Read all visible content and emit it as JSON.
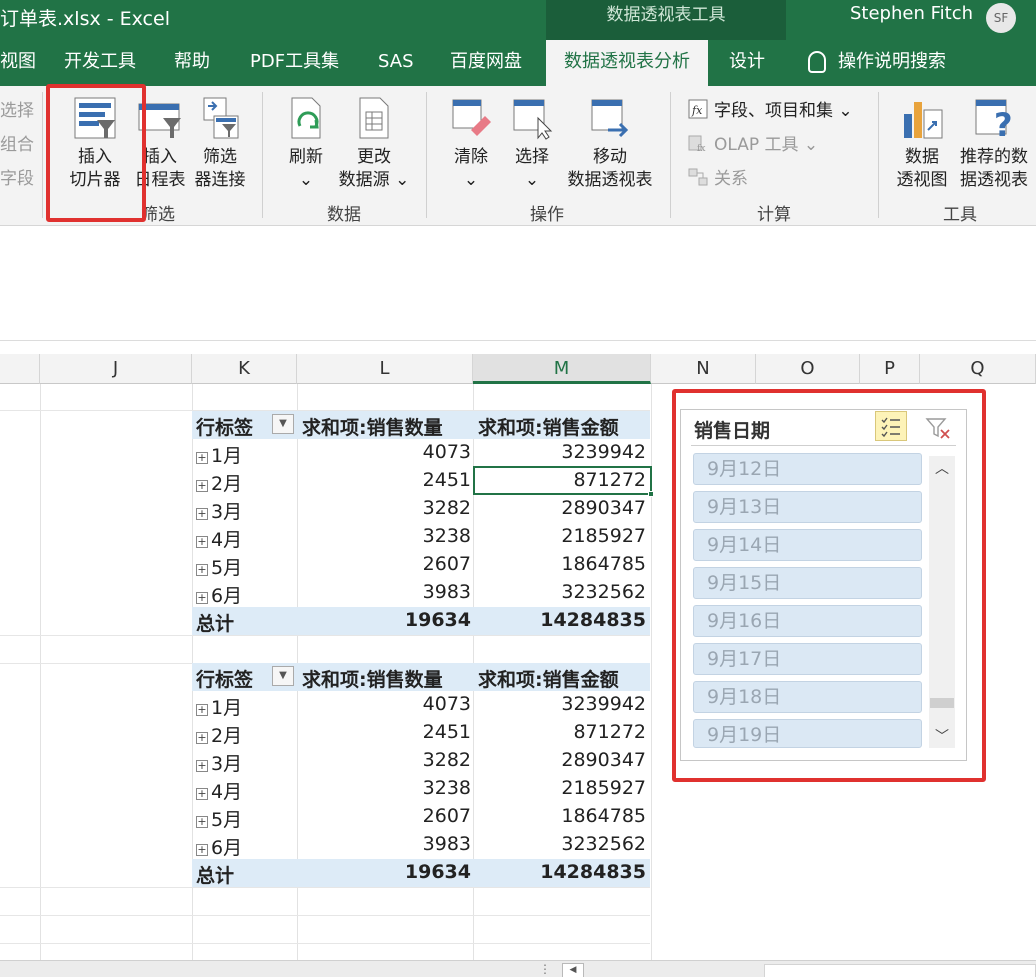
{
  "window": {
    "title": "订单表.xlsx  -  Excel",
    "context_tab_group": "数据透视表工具",
    "user_name": "Stephen Fitch",
    "user_initials": "SF"
  },
  "tabs": {
    "view": "视图",
    "developer": "开发工具",
    "help": "帮助",
    "pdf": "PDF工具集",
    "sas": "SAS",
    "baidu": "百度网盘",
    "pivot_analyze": "数据透视表分析",
    "design": "设计",
    "tell_me": "操作说明搜索"
  },
  "ribbon": {
    "group_select": {
      "item1": "选择",
      "item2": "组合",
      "item3": "字段"
    },
    "insert_slicer": {
      "line1": "插入",
      "line2": "切片器"
    },
    "insert_timeline": {
      "line1": "插入",
      "line2": "日程表"
    },
    "filter_connections": {
      "line1": "筛选",
      "line2": "器连接"
    },
    "filter_group_label": "筛选",
    "refresh": {
      "line1": "刷新",
      "line2": "⌄"
    },
    "change_source": {
      "line1": "更改",
      "line2": "数据源 ⌄"
    },
    "data_group_label": "数据",
    "clear": {
      "line1": "清除",
      "line2": "⌄"
    },
    "select": {
      "line1": "选择",
      "line2": "⌄"
    },
    "move": {
      "line1": "移动",
      "line2": "数据透视表"
    },
    "actions_group_label": "操作",
    "fields_items_sets": "字段、项目和集 ⌄",
    "olap_tools": "OLAP 工具 ⌄",
    "relationships": "关系",
    "calc_group_label": "计算",
    "pivot_chart": {
      "line1": "数据",
      "line2": "透视图"
    },
    "recommended_pivot": {
      "line1": "推荐的数",
      "line2": "据透视表"
    },
    "tools_group_label": "工具"
  },
  "columns": [
    "J",
    "K",
    "L",
    "M",
    "N",
    "O",
    "P",
    "Q"
  ],
  "pivot_header": {
    "row_label": "行标签",
    "sum_qty": "求和项:销售数量",
    "sum_amount": "求和项:销售金额"
  },
  "pivot1": [
    {
      "label": "1月",
      "qty": "4073",
      "amount": "3239942"
    },
    {
      "label": "2月",
      "qty": "2451",
      "amount": "871272"
    },
    {
      "label": "3月",
      "qty": "3282",
      "amount": "2890347"
    },
    {
      "label": "4月",
      "qty": "3238",
      "amount": "2185927"
    },
    {
      "label": "5月",
      "qty": "2607",
      "amount": "1864785"
    },
    {
      "label": "6月",
      "qty": "3983",
      "amount": "3232562"
    }
  ],
  "pivot1_total": {
    "label": "总计",
    "qty": "19634",
    "amount": "14284835"
  },
  "pivot2": [
    {
      "label": "1月",
      "qty": "4073",
      "amount": "3239942"
    },
    {
      "label": "2月",
      "qty": "2451",
      "amount": "871272"
    },
    {
      "label": "3月",
      "qty": "3282",
      "amount": "2890347"
    },
    {
      "label": "4月",
      "qty": "3238",
      "amount": "2185927"
    },
    {
      "label": "5月",
      "qty": "2607",
      "amount": "1864785"
    },
    {
      "label": "6月",
      "qty": "3983",
      "amount": "3232562"
    }
  ],
  "pivot2_total": {
    "label": "总计",
    "qty": "19634",
    "amount": "14284835"
  },
  "slicer": {
    "title": "销售日期",
    "items": [
      "9月12日",
      "9月13日",
      "9月14日",
      "9月15日",
      "9月16日",
      "9月17日",
      "9月18日",
      "9月19日"
    ]
  },
  "colors": {
    "excel_green": "#217346",
    "highlight_red": "#e0312f",
    "pivot_header_fill": "#ddebf7",
    "slicer_item_fill": "#dbe8f4"
  }
}
